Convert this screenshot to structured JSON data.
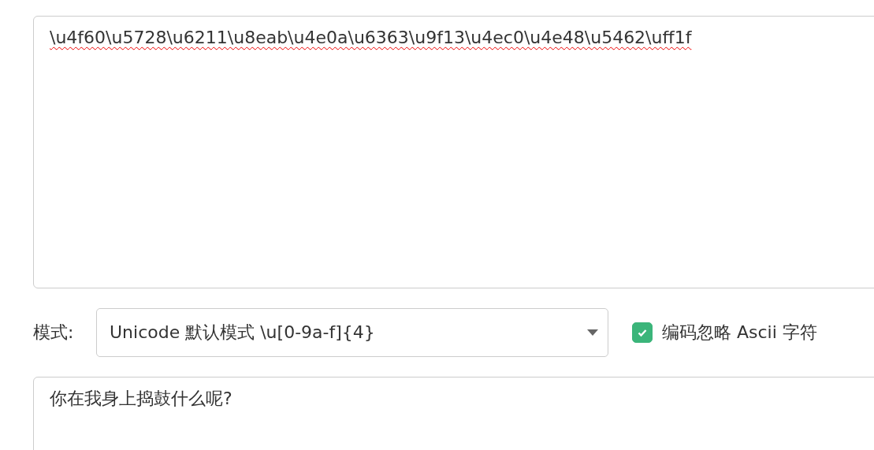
{
  "input_area": {
    "value": "\\u4f60\\u5728\\u6211\\u8eab\\u4e0a\\u6363\\u9f13\\u4ec0\\u4e48\\u5462\\uff1f"
  },
  "mode": {
    "label": "模式:",
    "value": "Unicode 默认模式 \\u[0-9a-f]{4}"
  },
  "ignore_ascii": {
    "label": "编码忽略 Ascii 字符",
    "checked": true
  },
  "output_area": {
    "value": "你在我身上捣鼓什么呢?"
  }
}
